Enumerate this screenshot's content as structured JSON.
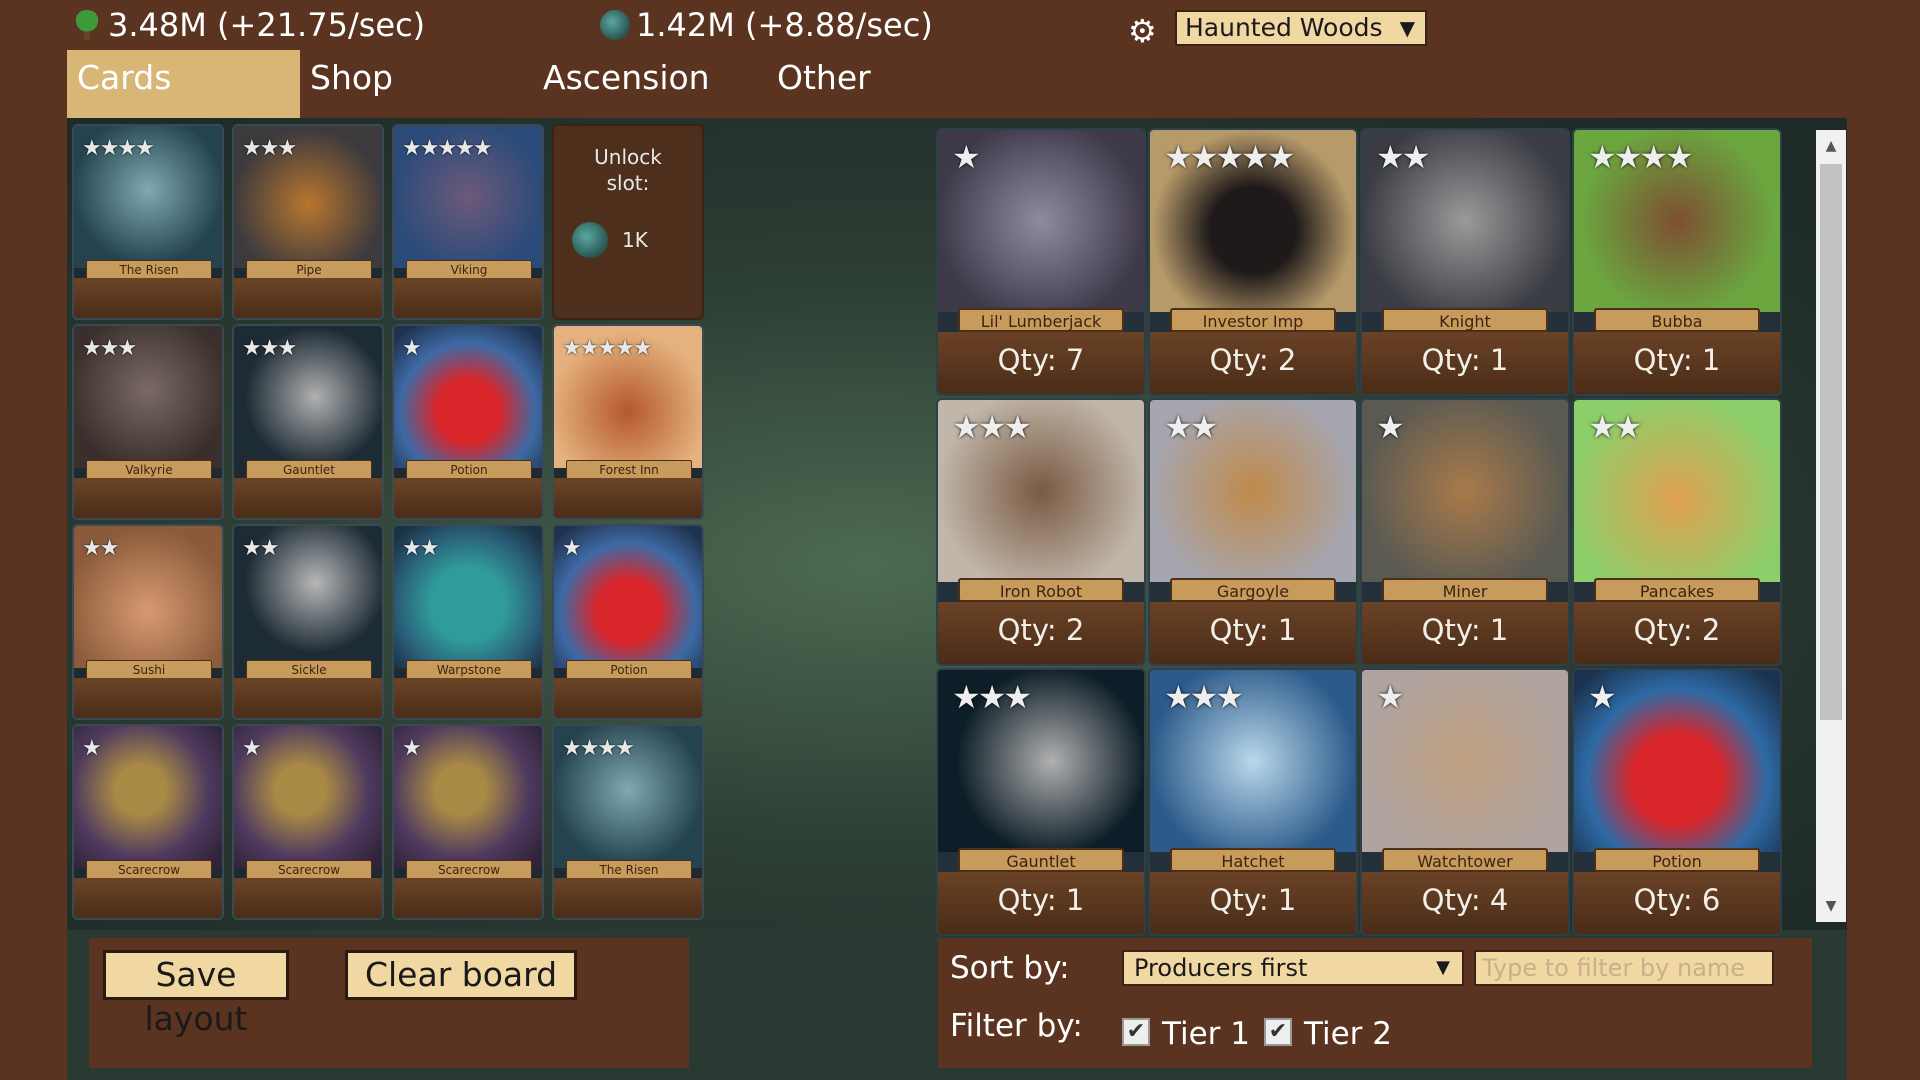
{
  "header": {
    "wood": "3.48M (+21.75/sec)",
    "stone": "1.42M (+8.88/sec)",
    "zone": "Haunted Woods",
    "settings_icon": "gear-icon"
  },
  "tabs": [
    {
      "label": "Cards",
      "active": true
    },
    {
      "label": "Shop",
      "active": false
    },
    {
      "label": "Ascension",
      "active": false
    },
    {
      "label": "Other",
      "active": false
    }
  ],
  "board": {
    "unlock_title": "Unlock slot:",
    "unlock_cost": "1K",
    "slots": [
      {
        "name": "The Risen",
        "stars": "★★★★"
      },
      {
        "name": "Pipe",
        "stars": "★★★"
      },
      {
        "name": "Viking",
        "stars": "★★★★★"
      },
      null,
      {
        "name": "Valkyrie",
        "stars": "★★★"
      },
      {
        "name": "Gauntlet",
        "stars": "★★★"
      },
      {
        "name": "Potion",
        "stars": "★"
      },
      {
        "name": "Forest Inn",
        "stars": "★★★★★"
      },
      {
        "name": "Sushi",
        "stars": "★★"
      },
      {
        "name": "Sickle",
        "stars": "★★"
      },
      {
        "name": "Warpstone",
        "stars": "★★"
      },
      {
        "name": "Potion",
        "stars": "★"
      },
      {
        "name": "Scarecrow",
        "stars": "★"
      },
      {
        "name": "Scarecrow",
        "stars": "★"
      },
      {
        "name": "Scarecrow",
        "stars": "★"
      },
      {
        "name": "The Risen",
        "stars": "★★★★"
      }
    ]
  },
  "inventory": [
    {
      "name": "Lil' Lumberjack",
      "stars": "★",
      "qty": "Qty: 7"
    },
    {
      "name": "Investor Imp",
      "stars": "★★★★★",
      "qty": "Qty: 2"
    },
    {
      "name": "Knight",
      "stars": "★★",
      "qty": "Qty: 1"
    },
    {
      "name": "Bubba",
      "stars": "★★★★",
      "qty": "Qty: 1"
    },
    {
      "name": "Iron Robot",
      "stars": "★★★",
      "qty": "Qty: 2"
    },
    {
      "name": "Gargoyle",
      "stars": "★★",
      "qty": "Qty: 1"
    },
    {
      "name": "Miner",
      "stars": "★",
      "qty": "Qty: 1"
    },
    {
      "name": "Pancakes",
      "stars": "★★",
      "qty": "Qty: 2"
    },
    {
      "name": "Gauntlet",
      "stars": "★★★",
      "qty": "Qty: 1"
    },
    {
      "name": "Hatchet",
      "stars": "★★★",
      "qty": "Qty: 1"
    },
    {
      "name": "Watchtower",
      "stars": "★",
      "qty": "Qty: 4"
    },
    {
      "name": "Potion",
      "stars": "★",
      "qty": "Qty: 6"
    }
  ],
  "controls": {
    "save_label": "Save layout",
    "clear_label": "Clear board",
    "sort_label": "Sort by:",
    "sort_value": "Producers first",
    "filter_placeholder": "Type to filter by name",
    "filter_label": "Filter by:",
    "tier1": "Tier 1",
    "tier2": "Tier 2"
  }
}
